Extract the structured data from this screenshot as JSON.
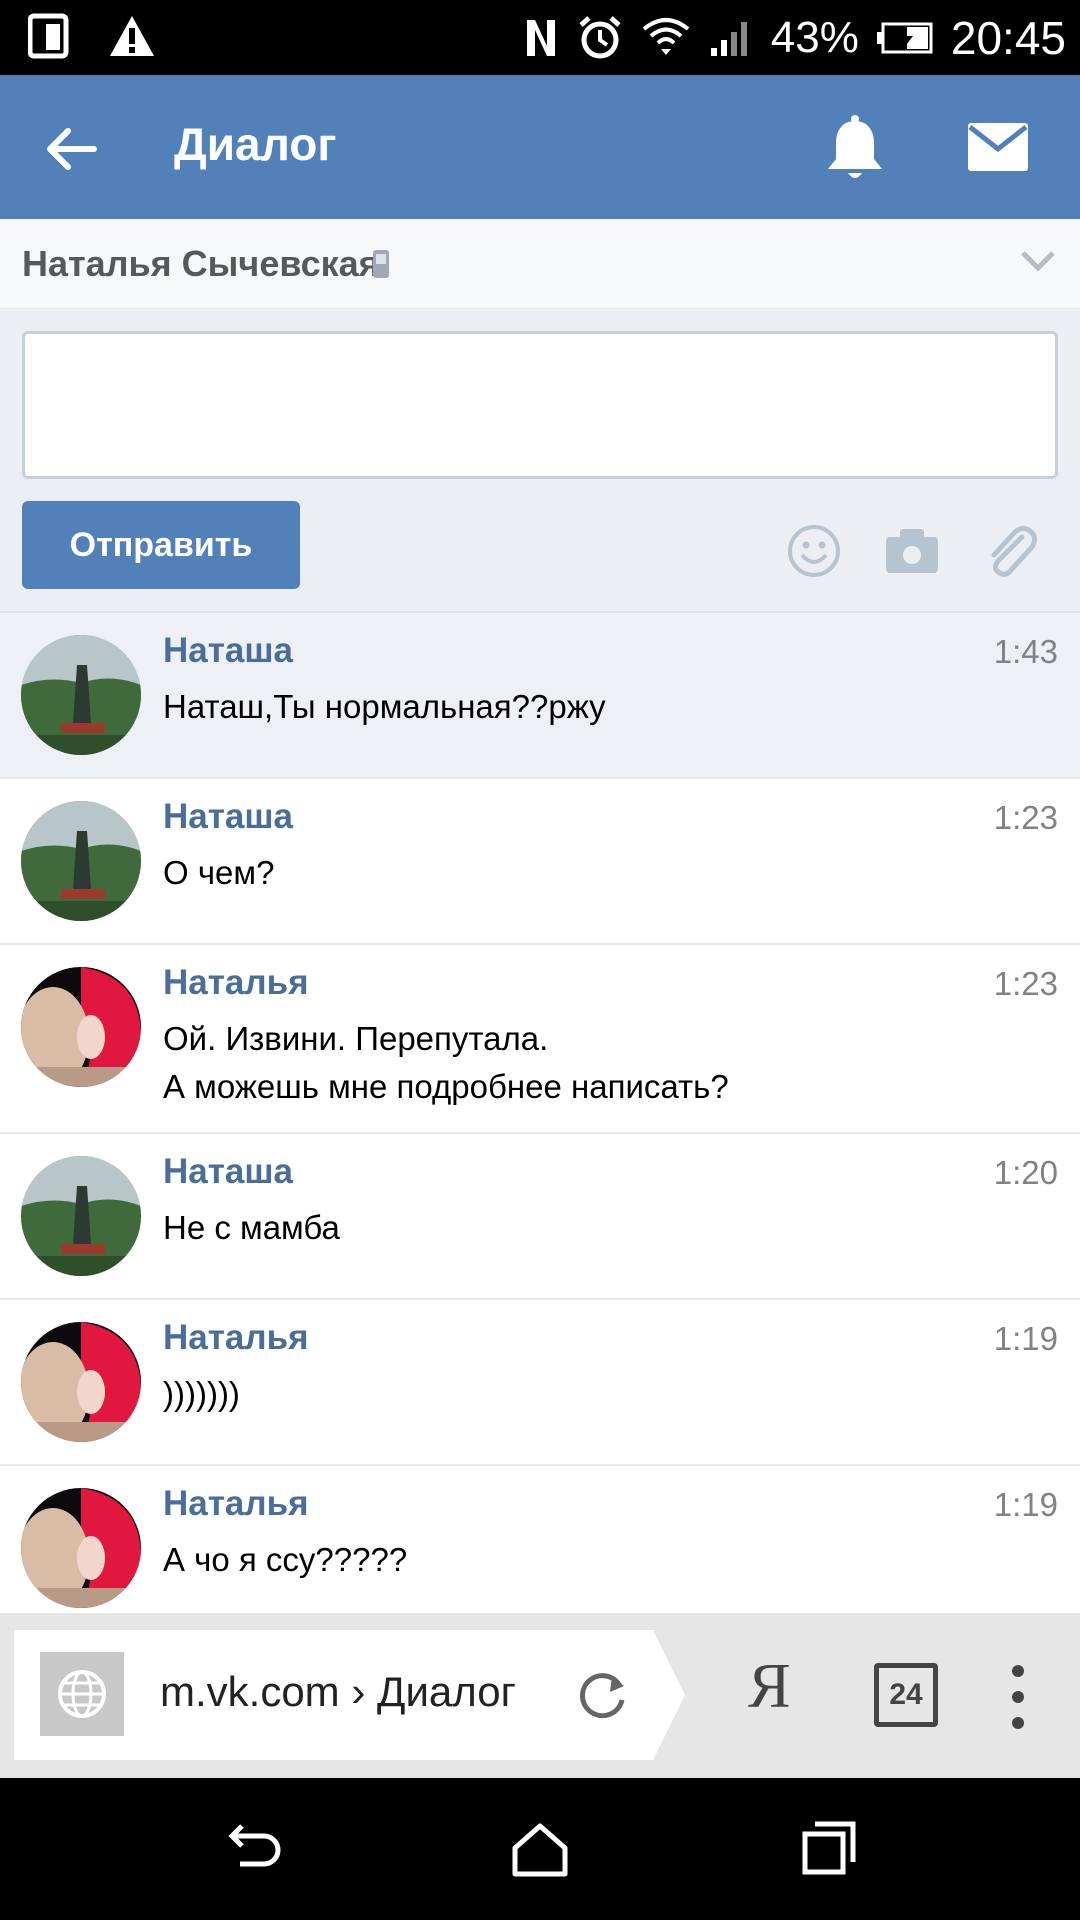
{
  "status_bar": {
    "battery": "43%",
    "time": "20:45"
  },
  "app_bar": {
    "title": "Диалог"
  },
  "contact": {
    "name": "Наталья Сычевская"
  },
  "compose": {
    "placeholder": "",
    "value": "",
    "send_label": "Отправить"
  },
  "messages": [
    {
      "author": "Наташа",
      "time": "1:43",
      "text": "Наташ,Ты нормальная??ржу",
      "avatar": "statue",
      "unread": true
    },
    {
      "author": "Наташа",
      "time": "1:23",
      "text": "О чем?",
      "avatar": "statue",
      "unread": false
    },
    {
      "author": "Наталья",
      "time": "1:23",
      "text": "Ой. Извини. Перепутала.\nА можешь мне подробнее написать?",
      "avatar": "redhair",
      "unread": false
    },
    {
      "author": "Наташа",
      "time": "1:20",
      "text": "Не с мамба",
      "avatar": "statue",
      "unread": false
    },
    {
      "author": "Наталья",
      "time": "1:19",
      "text": ")))))))",
      "avatar": "redhair",
      "unread": false
    },
    {
      "author": "Наталья",
      "time": "1:19",
      "text": "А чо я ссу?????",
      "avatar": "redhair",
      "unread": false
    }
  ],
  "browser": {
    "url": "m.vk.com › Диалог",
    "yandex_glyph": "Я",
    "tab_count": "24"
  },
  "colors": {
    "accent": "#5181b8",
    "author": "#4a6d99",
    "unread_bg": "#edf0f5"
  }
}
